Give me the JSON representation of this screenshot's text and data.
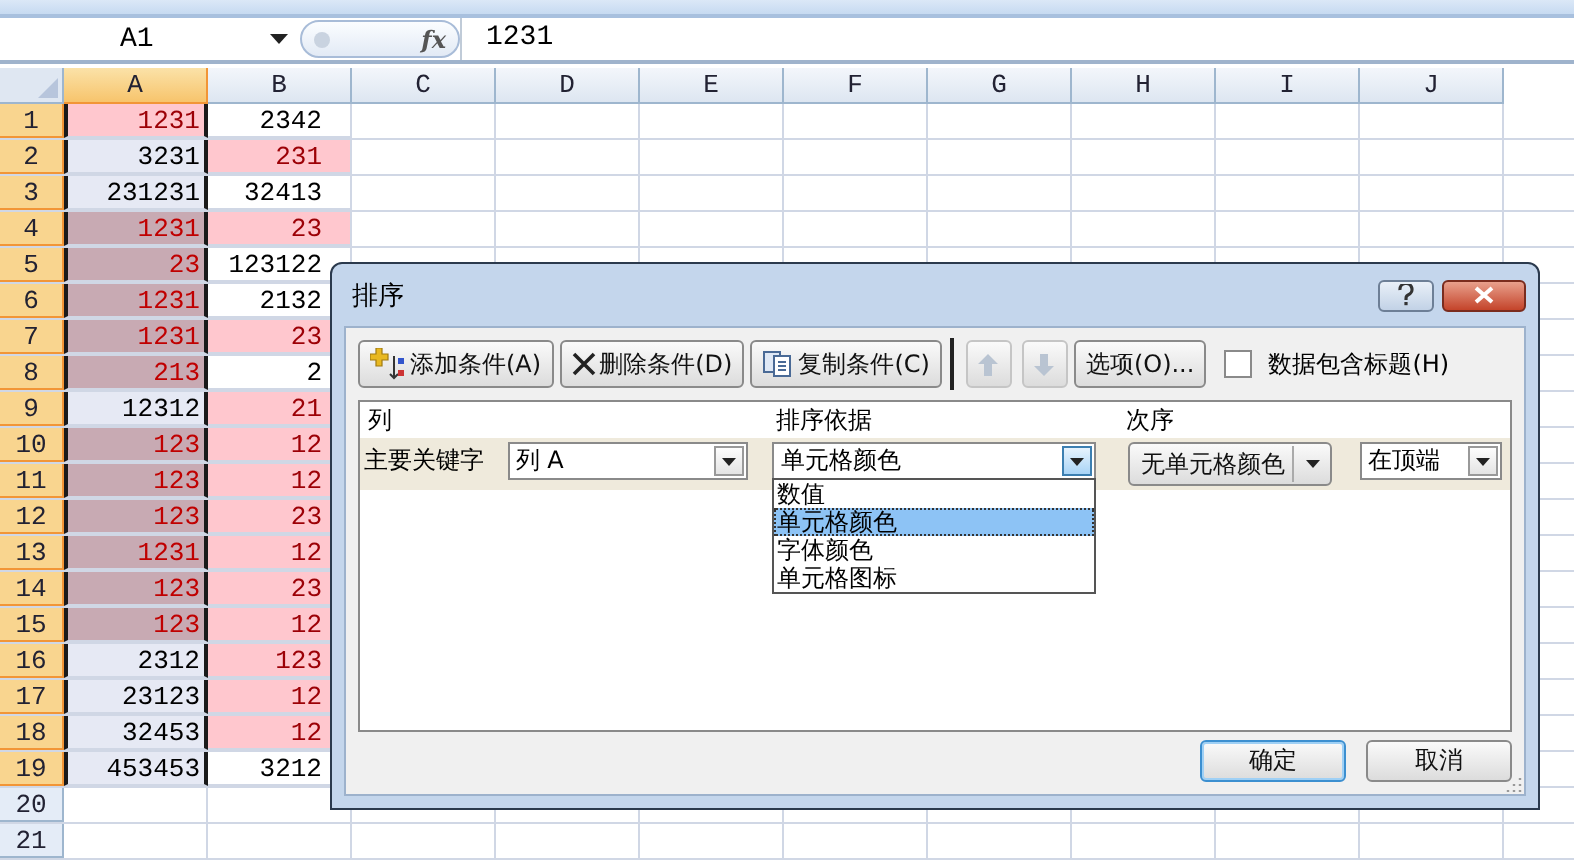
{
  "formula_bar": {
    "name_box": "A1",
    "function_label": "fx",
    "value": "1231"
  },
  "columns": [
    {
      "label": "A",
      "selected": true
    },
    {
      "label": "B",
      "selected": false
    },
    {
      "label": "C",
      "selected": false
    },
    {
      "label": "D",
      "selected": false
    },
    {
      "label": "E",
      "selected": false
    },
    {
      "label": "F",
      "selected": false
    },
    {
      "label": "G",
      "selected": false
    },
    {
      "label": "H",
      "selected": false
    },
    {
      "label": "I",
      "selected": false
    },
    {
      "label": "J",
      "selected": false
    }
  ],
  "rows": [
    {
      "number": "1",
      "selected": true,
      "cells": [
        {
          "value": "1231",
          "kind": "pink"
        },
        {
          "value": "2342",
          "kind": "plain"
        }
      ]
    },
    {
      "number": "2",
      "selected": true,
      "cells": [
        {
          "value": "3231",
          "kind": "shaded"
        },
        {
          "value": "231",
          "kind": "pink"
        }
      ]
    },
    {
      "number": "3",
      "selected": true,
      "cells": [
        {
          "value": "231231",
          "kind": "shaded"
        },
        {
          "value": "32413",
          "kind": "plain"
        }
      ]
    },
    {
      "number": "4",
      "selected": true,
      "cells": [
        {
          "value": "1231",
          "kind": "mauve"
        },
        {
          "value": "23",
          "kind": "pink"
        }
      ]
    },
    {
      "number": "5",
      "selected": true,
      "cells": [
        {
          "value": "23",
          "kind": "mauve"
        },
        {
          "value": "123122",
          "kind": "plain"
        }
      ]
    },
    {
      "number": "6",
      "selected": true,
      "cells": [
        {
          "value": "1231",
          "kind": "mauve"
        },
        {
          "value": "2132",
          "kind": "plain"
        }
      ]
    },
    {
      "number": "7",
      "selected": true,
      "cells": [
        {
          "value": "1231",
          "kind": "mauve"
        },
        {
          "value": "23",
          "kind": "pink"
        }
      ]
    },
    {
      "number": "8",
      "selected": true,
      "cells": [
        {
          "value": "213",
          "kind": "mauve"
        },
        {
          "value": "2",
          "kind": "plain"
        }
      ]
    },
    {
      "number": "9",
      "selected": true,
      "cells": [
        {
          "value": "12312",
          "kind": "shaded"
        },
        {
          "value": "21",
          "kind": "pink"
        }
      ]
    },
    {
      "number": "10",
      "selected": true,
      "cells": [
        {
          "value": "123",
          "kind": "mauve"
        },
        {
          "value": "12",
          "kind": "pink"
        }
      ]
    },
    {
      "number": "11",
      "selected": true,
      "cells": [
        {
          "value": "123",
          "kind": "mauve"
        },
        {
          "value": "12",
          "kind": "pink"
        }
      ]
    },
    {
      "number": "12",
      "selected": true,
      "cells": [
        {
          "value": "123",
          "kind": "mauve"
        },
        {
          "value": "23",
          "kind": "pink"
        }
      ]
    },
    {
      "number": "13",
      "selected": true,
      "cells": [
        {
          "value": "1231",
          "kind": "mauve"
        },
        {
          "value": "12",
          "kind": "pink"
        }
      ]
    },
    {
      "number": "14",
      "selected": true,
      "cells": [
        {
          "value": "123",
          "kind": "mauve"
        },
        {
          "value": "23",
          "kind": "pink"
        }
      ]
    },
    {
      "number": "15",
      "selected": true,
      "cells": [
        {
          "value": "123",
          "kind": "mauve"
        },
        {
          "value": "12",
          "kind": "pink"
        }
      ]
    },
    {
      "number": "16",
      "selected": true,
      "cells": [
        {
          "value": "2312",
          "kind": "shaded"
        },
        {
          "value": "123",
          "kind": "pink"
        }
      ]
    },
    {
      "number": "17",
      "selected": true,
      "cells": [
        {
          "value": "23123",
          "kind": "shaded"
        },
        {
          "value": "12",
          "kind": "pink"
        }
      ]
    },
    {
      "number": "18",
      "selected": true,
      "cells": [
        {
          "value": "32453",
          "kind": "shaded"
        },
        {
          "value": "12",
          "kind": "pink"
        }
      ]
    },
    {
      "number": "19",
      "selected": true,
      "cells": [
        {
          "value": "453453",
          "kind": "shaded"
        },
        {
          "value": "3212",
          "kind": "plain"
        }
      ]
    },
    {
      "number": "20",
      "selected": false,
      "cells": []
    },
    {
      "number": "21",
      "selected": false,
      "cells": []
    }
  ],
  "dialog": {
    "title": "排序",
    "toolbar": [
      {
        "kind": "add",
        "label": "添加条件(A)",
        "disabled": false
      },
      {
        "kind": "delete",
        "label": "删除条件(D)",
        "disabled": false
      },
      {
        "kind": "copy",
        "label": "复制条件(C)",
        "disabled": false
      },
      {
        "kind": "up",
        "disabled": true
      },
      {
        "kind": "down",
        "disabled": true
      },
      {
        "kind": "text",
        "label": "选项(O)...",
        "disabled": false
      }
    ],
    "header_checkbox": {
      "label": "数据包含标题(H)",
      "checked": false
    },
    "list_headers": [
      "列",
      "排序依据",
      "次序"
    ],
    "criteria": [
      {
        "label": "主要关键字",
        "column": "列 A",
        "sort_on": "单元格颜色",
        "cell_color": "无单元格颜色",
        "order": "在顶端",
        "expanded": true,
        "sort_on_options": [
          {
            "label": "数值",
            "selected": false
          },
          {
            "label": "单元格颜色",
            "selected": true
          },
          {
            "label": "字体颜色",
            "selected": false
          },
          {
            "label": "单元格图标",
            "selected": false
          }
        ]
      }
    ],
    "buttons": [
      "确定",
      "取消"
    ]
  }
}
